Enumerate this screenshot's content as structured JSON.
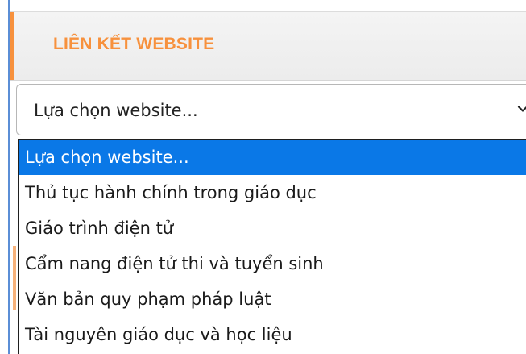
{
  "widget": {
    "title": "LIÊN KẾT WEBSITE",
    "accent_color": "#f7913d",
    "border_color": "#5b8ed6"
  },
  "select": {
    "current_value": "Lựa chọn website...",
    "chevron_icon": "chevron-down-icon"
  },
  "dropdown": {
    "highlight_color": "#0a78e7",
    "selected_index": 0,
    "options": [
      "Lựa chọn website...",
      "Thủ tục hành chính trong giáo dục",
      "Giáo trình điện tử",
      "Cẩm nang điện tử thi và tuyển sinh",
      "Văn bản quy phạm pháp luật",
      "Tài nguyên giáo dục và học liệu"
    ]
  }
}
